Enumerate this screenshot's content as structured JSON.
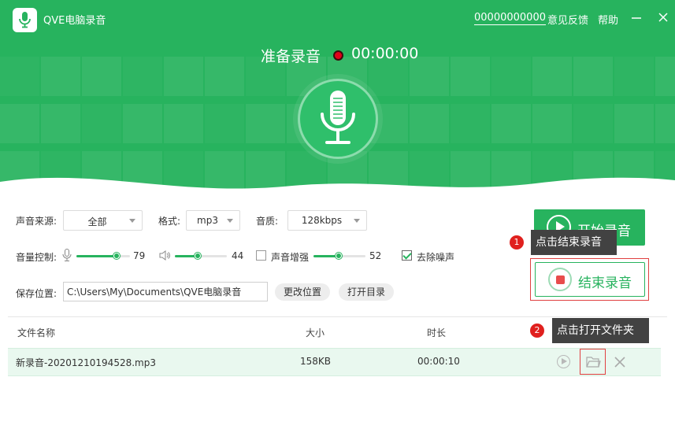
{
  "app": {
    "title": "QVE电脑录音",
    "account": "00000000000",
    "feedback": "意见反馈",
    "help": "帮助"
  },
  "status": {
    "text": "准备录音",
    "timer": "00:00:00"
  },
  "settings": {
    "source_label": "声音来源:",
    "source_value": "全部",
    "format_label": "格式:",
    "format_value": "mp3",
    "quality_label": "音质:",
    "quality_value": "128kbps",
    "volume_label": "音量控制:",
    "mic_volume": "79",
    "speaker_volume": "44",
    "boost_label": "声音增强",
    "boost_checked": false,
    "boost_value": "52",
    "denoise_label": "去除噪声",
    "denoise_checked": true,
    "save_label": "保存位置:",
    "save_path": "C:\\Users\\My\\Documents\\QVE电脑录音",
    "change_location": "更改位置",
    "open_dir": "打开目录"
  },
  "actions": {
    "start": "开始录音",
    "stop": "结束录音"
  },
  "tips": [
    {
      "number": "1",
      "text": "点击结束录音"
    },
    {
      "number": "2",
      "text": "点击打开文件夹"
    }
  ],
  "table": {
    "headers": [
      "文件名称",
      "大小",
      "时长"
    ],
    "rows": [
      {
        "name": "新录音-20201210194528.mp3",
        "size": "158KB",
        "duration": "00:00:10"
      }
    ]
  },
  "colors": {
    "brand": "#27b35e",
    "record_dot": "#e0001a",
    "highlight_border": "#e04040"
  }
}
